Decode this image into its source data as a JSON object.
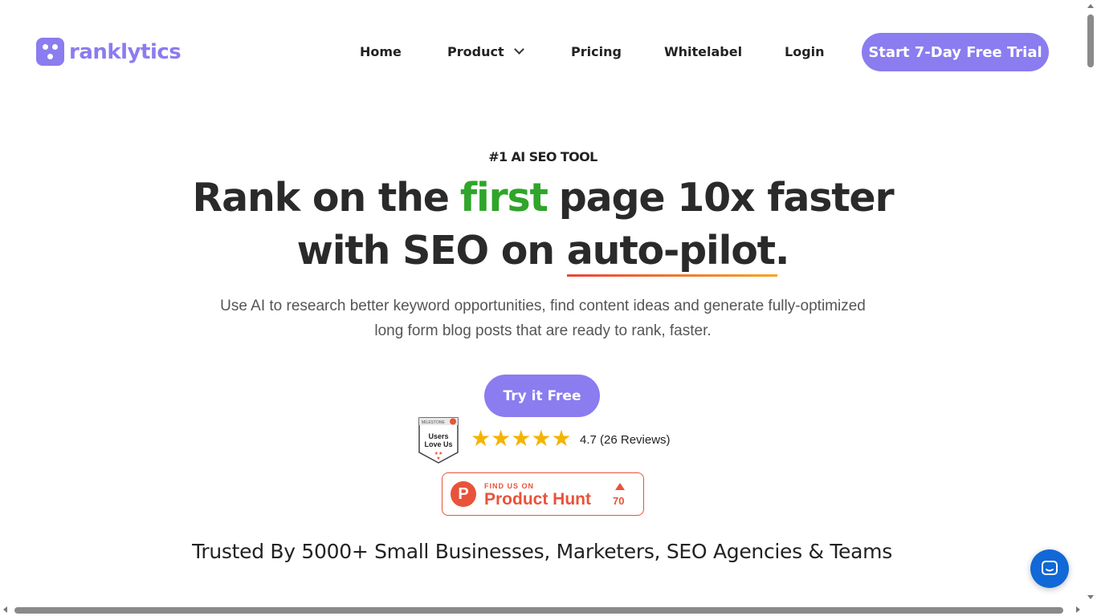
{
  "brand": {
    "name": "ranklytics",
    "color": "#8b7cf0"
  },
  "nav": {
    "items": [
      "Home",
      "Product",
      "Pricing",
      "Whitelabel",
      "Login"
    ],
    "cta_label": "Start 7-Day Free Trial"
  },
  "hero": {
    "eyebrow": "#1 AI SEO TOOL",
    "line1_pre": "Rank on the",
    "line1_highlight": "first",
    "line1_post": "page 10x faster",
    "line2_pre": "with SEO on",
    "line2_underlined": "auto-pilot",
    "line2_post": ".",
    "subtitle": "Use AI to research better keyword opportunities, find content ideas and generate fully-optimized long form blog posts that are ready to rank, faster.",
    "cta_label": "Try it Free",
    "highlight_color": "#2fa52a"
  },
  "reviews": {
    "badge_top": "MILESTONE",
    "badge_text": "Users Love Us",
    "stars": 5,
    "rating_text": "4.7 (26 Reviews)"
  },
  "product_hunt": {
    "small": "FIND US ON",
    "big": "Product Hunt",
    "upvotes": "70",
    "color": "#e8533a"
  },
  "trusted": "Trusted By 5000+ Small Businesses, Marketers, SEO Agencies & Teams",
  "icons": {
    "chat": "chat-bubble-icon",
    "chevron": "chevron-down-icon"
  }
}
